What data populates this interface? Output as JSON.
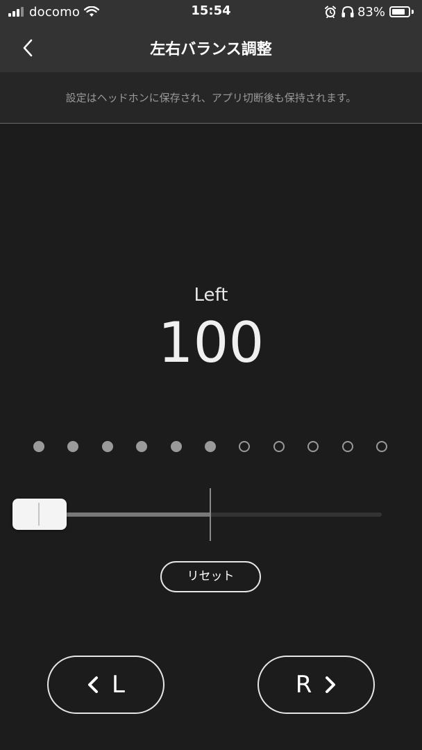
{
  "status_bar": {
    "carrier": "docomo",
    "time": "15:54",
    "battery_percent": "83%",
    "battery_level": 0.83,
    "icons": [
      "signal-icon",
      "wifi-icon",
      "alarm-icon",
      "headphones-icon",
      "battery-icon"
    ]
  },
  "nav": {
    "back_icon": "chevron-left-icon",
    "title": "左右バランス調整"
  },
  "info": {
    "text": "設定はヘッドホンに保存され、アプリ切断後も保持されます。"
  },
  "balance": {
    "side_label": "Left",
    "value": "100",
    "level_dots_total": 11,
    "level_dots_filled": 6,
    "slider_position": 0.0
  },
  "buttons": {
    "reset_label": "リセット",
    "left_label": "L",
    "right_label": "R",
    "left_icon": "chevron-left-icon",
    "right_icon": "chevron-right-icon"
  },
  "colors": {
    "background": "#1c1c1c",
    "bar_background": "#333333",
    "dot_color": "#9a9a9a",
    "thumb_color": "#f4f4f4"
  }
}
